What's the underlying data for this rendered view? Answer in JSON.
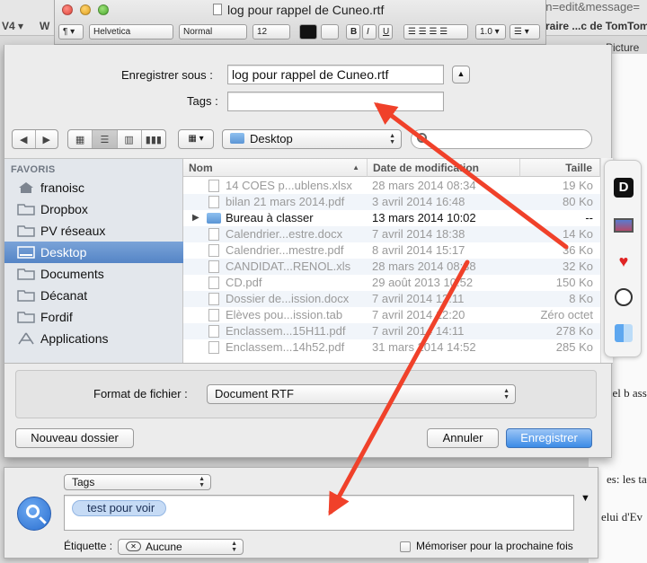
{
  "background": {
    "url_fragment": "on=edit&message=",
    "tab_v4": "V4 ▾",
    "tab_w": "W",
    "tab_raire": "raire ...c de TomTom",
    "picture_label": "Picture",
    "side_text": [
      "giciel b  asse un j",
      "es: les tag",
      "elui d'Ev"
    ]
  },
  "textedit": {
    "title": "log pour rappel de Cuneo.rtf",
    "toolbar": {
      "paragraph": "¶ ▾",
      "font": "Helvetica",
      "style": "Normal",
      "size": "12",
      "bold": "B",
      "italic": "I",
      "underline": "U",
      "spacing": "1.0 ▾",
      "list": "☰ ▾"
    }
  },
  "save_sheet": {
    "save_as_label": "Enregistrer sous :",
    "save_as_value": "log pour rappel de Cuneo.rtf",
    "tags_label": "Tags :",
    "tags_value": "",
    "location": "Desktop",
    "sidebar": {
      "header": "FAVORIS",
      "items": [
        {
          "label": "franoisc",
          "icon": "home-icon"
        },
        {
          "label": "Dropbox",
          "icon": "folder-icon"
        },
        {
          "label": "PV réseaux",
          "icon": "folder-icon"
        },
        {
          "label": "Desktop",
          "icon": "desktop-icon",
          "selected": true
        },
        {
          "label": "Documents",
          "icon": "documents-icon"
        },
        {
          "label": "Décanat",
          "icon": "folder-icon"
        },
        {
          "label": "Fordif",
          "icon": "folder-icon"
        },
        {
          "label": "Applications",
          "icon": "applications-icon"
        }
      ]
    },
    "columns": {
      "name": "Nom",
      "date": "Date de modification",
      "size": "Taille"
    },
    "files": [
      {
        "name": "14 COES p...ublens.xlsx",
        "date": "28 mars 2014 08:34",
        "size": "19 Ko",
        "kind": "file"
      },
      {
        "name": "bilan 21 mars 2014.pdf",
        "date": "3 avril 2014 16:48",
        "size": "80 Ko",
        "kind": "file"
      },
      {
        "name": "Bureau à classer",
        "date": "13 mars 2014 10:02",
        "size": "--",
        "kind": "folder"
      },
      {
        "name": "Calendrier...estre.docx",
        "date": "7 avril 2014 18:38",
        "size": "14 Ko",
        "kind": "file"
      },
      {
        "name": "Calendrier...mestre.pdf",
        "date": "8 avril 2014 15:17",
        "size": "36 Ko",
        "kind": "file"
      },
      {
        "name": "CANDIDAT...RENOL.xls",
        "date": "28 mars 2014 08:38",
        "size": "32 Ko",
        "kind": "file"
      },
      {
        "name": "CD.pdf",
        "date": "29 août 2013 10:52",
        "size": "150 Ko",
        "kind": "file"
      },
      {
        "name": "Dossier de...ission.docx",
        "date": "7 avril 2014 12:11",
        "size": "8 Ko",
        "kind": "file"
      },
      {
        "name": "Elèves pou...ission.tab",
        "date": "7 avril 2014 12:20",
        "size": "Zéro octet",
        "kind": "file"
      },
      {
        "name": "Enclassem...15H11.pdf",
        "date": "7 avril 2014 14:11",
        "size": "278 Ko",
        "kind": "file"
      },
      {
        "name": "Enclassem...14h52.pdf",
        "date": "31 mars 2014 14:52",
        "size": "285 Ko",
        "kind": "file"
      }
    ],
    "format_label": "Format de fichier :",
    "format_value": "Document RTF",
    "new_folder_button": "Nouveau dossier",
    "cancel_button": "Annuler",
    "save_button": "Enregistrer"
  },
  "tag_panel": {
    "tags_popup": "Tags",
    "tag_chip": "test pour voir",
    "label_title": "Étiquette :",
    "label_value": "Aucune",
    "remember_label": "Mémoriser pour la prochaine fois"
  },
  "colors": {
    "arrow": "#f0412a",
    "selection": "#5585c6",
    "primary_button": "#3b8be6"
  }
}
